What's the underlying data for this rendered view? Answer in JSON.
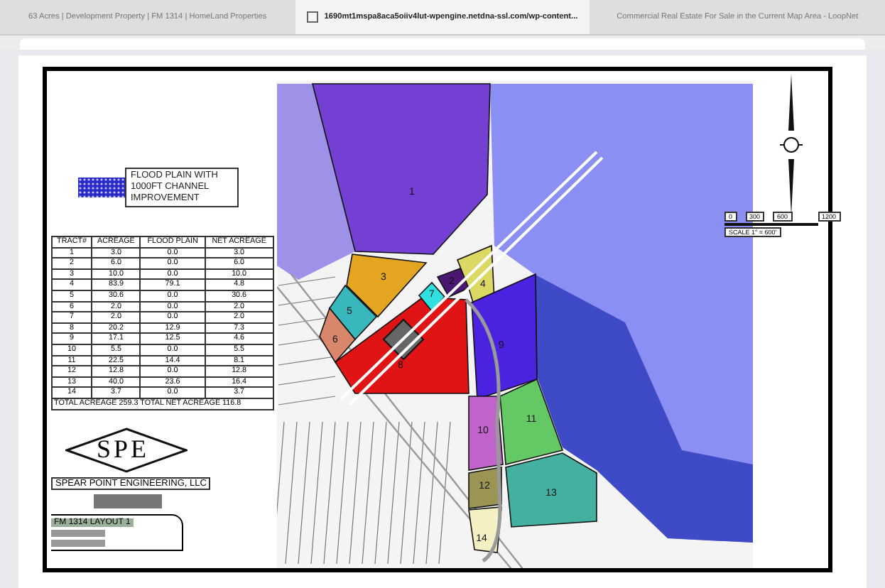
{
  "tabs": [
    {
      "label": "63 Acres | Development Property | FM 1314 | HomeLand Properties",
      "selected": false
    },
    {
      "label": "1690mt1mspa8aca5oiiv4lut-wpengine.netdna-ssl.com/wp-content...",
      "selected": true
    },
    {
      "label": "Commercial Real Estate For Sale in the Current Map Area - LoopNet",
      "selected": false
    }
  ],
  "legend": {
    "text": "FLOOD PLAIN WITH 1000FT CHANNEL IMPROVEMENT"
  },
  "table": {
    "columns": [
      "TRACT#",
      "ACREAGE",
      "FLOOD PLAIN",
      "NET ACREAGE"
    ],
    "rows": [
      [
        "1",
        "3.0",
        "0.0",
        "3.0"
      ],
      [
        "2",
        "6.0",
        "0.0",
        "6.0"
      ],
      [
        "3",
        "10.0",
        "0.0",
        "10.0"
      ],
      [
        "4",
        "83.9",
        "79.1",
        "4.8"
      ],
      [
        "5",
        "30.6",
        "0.0",
        "30.6"
      ],
      [
        "6",
        "2.0",
        "0.0",
        "2.0"
      ],
      [
        "7",
        "2.0",
        "0.0",
        "2.0"
      ],
      [
        "8",
        "20.2",
        "12.9",
        "7.3"
      ],
      [
        "9",
        "17.1",
        "12.5",
        "4.6"
      ],
      [
        "10",
        "5.5",
        "0.0",
        "5.5"
      ],
      [
        "11",
        "22.5",
        "14.4",
        "8.1"
      ],
      [
        "12",
        "12.8",
        "0.0",
        "12.8"
      ],
      [
        "13",
        "40.0",
        "23.6",
        "16.4"
      ],
      [
        "14",
        "3.7",
        "0.0",
        "3.7"
      ]
    ],
    "total": "TOTAL ACREAGE 259.3  TOTAL NET ACREAGE 116.8"
  },
  "logo": {
    "mark": "SPE",
    "company": "SPEAR POINT ENGINEERING, LLC"
  },
  "title_block": {
    "title": "FM 1314 LAYOUT 1"
  },
  "map": {
    "tracts": [
      {
        "label": "1",
        "color": "#7440d4"
      },
      {
        "label": "3",
        "color": "#e4a620"
      },
      {
        "label": "5",
        "color": "#38b8bc"
      },
      {
        "label": "6",
        "color": "#d8866c"
      },
      {
        "label": "8",
        "color": "#e01414"
      },
      {
        "label": "7",
        "color": "#30e0e0"
      },
      {
        "label": "2",
        "color": "#4a1870"
      },
      {
        "label": "4",
        "color": "#dcd864"
      },
      {
        "label": "9",
        "color": "#4a22e0"
      },
      {
        "label": "10",
        "color": "#c064cc"
      },
      {
        "label": "11",
        "color": "#64c864"
      },
      {
        "label": "13",
        "color": "#44b0a0"
      },
      {
        "label": "12",
        "color": "#9c9454"
      },
      {
        "label": "14",
        "color": "#f4f0c4"
      }
    ]
  },
  "scale": {
    "ticks": [
      "0",
      "300",
      "600",
      "1200"
    ],
    "caption": "SCALE 1\" = 600'"
  }
}
